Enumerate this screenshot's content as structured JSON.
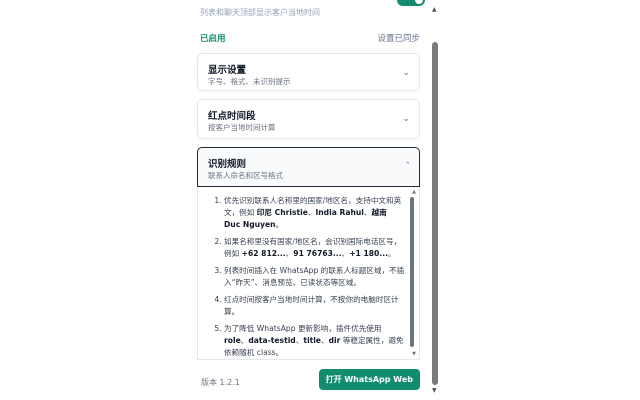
{
  "header": {
    "description": "列表和聊天顶部显示客户当地时间"
  },
  "status": {
    "enabled": "已启用",
    "synced": "设置已同步"
  },
  "sections": [
    {
      "title": "显示设置",
      "subtitle": "字号、格式、未识别提示",
      "state": "collapsed"
    },
    {
      "title": "红点时间段",
      "subtitle": "按客户当地时间计算",
      "state": "collapsed"
    },
    {
      "title": "识别规则",
      "subtitle": "联系人命名和区号格式",
      "state": "expanded"
    }
  ],
  "rules": {
    "r1": {
      "t1": "优先识别联系人名称里的国家/地区名，支持中文和英文，例如 ",
      "b1": "印尼 Christie",
      "t2": "、",
      "b2": "India Rahul",
      "t3": "、",
      "b3": "越南 Duc Nguyen",
      "t4": "。"
    },
    "r2": {
      "t1": "如果名称里没有国家/地区名，会识别国际电话区号，例如 ",
      "b1": "+62 812...",
      "t2": "、",
      "b2": "91 76763...",
      "t3": "、",
      "b3": "+1 180...",
      "t4": "。"
    },
    "r3": {
      "text": "列表时间插入在 WhatsApp 的联系人标题区域，不插入“昨天”、消息预览、已读状态等区域。"
    },
    "r4": {
      "text": "红点时间按客户当地时间计算，不按你的电脑时区计算。"
    },
    "r5": {
      "t1": "为了降低 WhatsApp 更新影响，插件优先使用 ",
      "b1": "role",
      "t2": "、",
      "b2": "data-testid",
      "t3": "、",
      "b3": "title",
      "t4": "、",
      "b4": "dir",
      "t5": " 等稳定属性，避免依赖随机 class。"
    }
  },
  "footer": {
    "version": "版本 1.2.1",
    "open_button": "打开 WhatsApp Web"
  },
  "colors": {
    "accent": "#128c6f"
  },
  "icons": {
    "collapsed": "chevron-down-icon",
    "expanded": "chevron-up-icon"
  }
}
